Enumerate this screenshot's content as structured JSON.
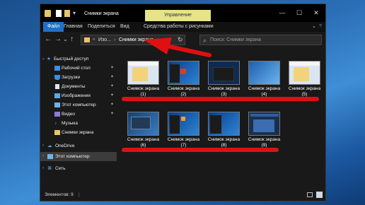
{
  "window": {
    "title": "Снимки экрана",
    "manage_tab": "Управление",
    "minimize": "—",
    "maximize": "☐",
    "close": "✕"
  },
  "ribbon": {
    "tabs": [
      "Файл",
      "Главная",
      "Поделиться",
      "Вид",
      "Средства работы с рисунками"
    ],
    "help": "?"
  },
  "address": {
    "back": "←",
    "forward": "→",
    "dropdown": "⌄",
    "up": "↑",
    "overflow": "«",
    "crumb1": "Изо...",
    "sep": "›",
    "crumb2": "Снимки экрана",
    "refresh": "↻",
    "search_placeholder": "Поиск: Снимки экрана",
    "search_icon": "⌕"
  },
  "sidebar": {
    "quick_access": "Быстрый доступ",
    "items": [
      {
        "label": "Рабочий стол",
        "icon": "desktop-icon",
        "pinned": true
      },
      {
        "label": "Загрузки",
        "icon": "download-icon",
        "pinned": true
      },
      {
        "label": "Документы",
        "icon": "documents-icon",
        "pinned": true
      },
      {
        "label": "Изображения",
        "icon": "pictures-icon",
        "pinned": true
      },
      {
        "label": "Этот компьютер",
        "icon": "computer-icon",
        "pinned": true
      },
      {
        "label": "Видео",
        "icon": "video-icon",
        "pinned": true
      },
      {
        "label": "Музыка",
        "icon": "music-icon",
        "pinned": false
      },
      {
        "label": "Снимки экрана",
        "icon": "folder-icon",
        "pinned": false
      }
    ],
    "onedrive": "OneDrive",
    "this_pc": "Этот компьютер",
    "network": "Сеть",
    "pin_glyph": "📌"
  },
  "files": [
    {
      "name": "Снимок экрана",
      "num": "(1)"
    },
    {
      "name": "Снимок экрана",
      "num": "(2)"
    },
    {
      "name": "Снимок экрана",
      "num": "(3)"
    },
    {
      "name": "Снимок экрана",
      "num": "(4)"
    },
    {
      "name": "Снимок экрана",
      "num": "(5)"
    },
    {
      "name": "Снимок экрана",
      "num": "(6)"
    },
    {
      "name": "Снимок экрана",
      "num": "(7)"
    },
    {
      "name": "Снимок экрана",
      "num": "(8)"
    },
    {
      "name": "Снимок экрана",
      "num": "(9)"
    }
  ],
  "status": {
    "count": "Элементов: 9",
    "sep": "|"
  },
  "colors": {
    "accent": "#1e71c7",
    "annotation_red": "#e01010",
    "manage_tab": "#e6e38c"
  }
}
